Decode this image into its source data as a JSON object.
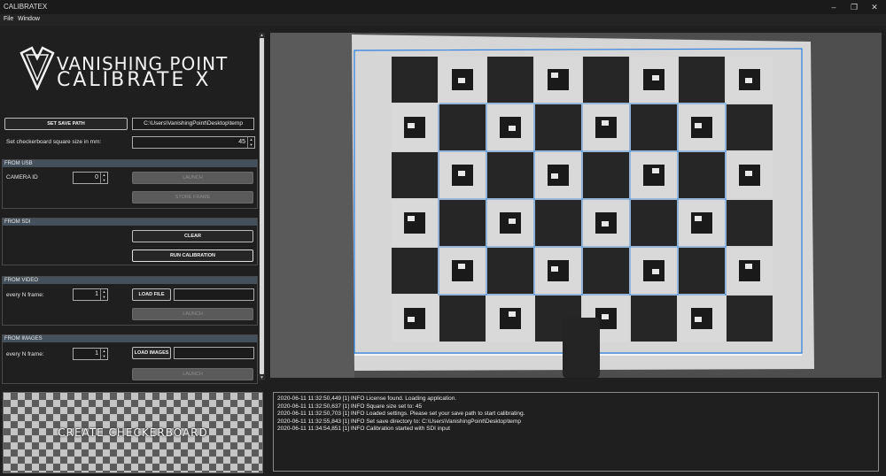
{
  "window": {
    "title": "CALIBRATEX"
  },
  "menu": [
    "File",
    "Window"
  ],
  "logo": {
    "line1": "VANISHING POINT",
    "line2": "CALIBRATE X"
  },
  "save": {
    "button_label": "SET SAVE PATH",
    "path": "C:\\Users\\VanishingPoint\\Desktop\\temp"
  },
  "square_size": {
    "label": "Set checkerboard square size in mm:",
    "value": "45"
  },
  "usb": {
    "header": "FROM USB",
    "camera_label": "CAMERA ID",
    "camera_value": "0",
    "launch_label": "LAUNCH",
    "store_label": "STORE FRAME"
  },
  "sdi": {
    "header": "FROM SDI",
    "clear_label": "CLEAR",
    "run_label": "RUN CALIBRATION"
  },
  "video": {
    "header": "FROM VIDEO",
    "every_label": "every N frame:",
    "every_value": "1",
    "load_label": "LOAD FILE",
    "launch_label": "LAUNCH"
  },
  "images": {
    "header": "FROM IMAGES",
    "every_label": "every N frame:",
    "every_value": "1",
    "load_label": "LOAD IMAGES",
    "launch_label": "LAUNCH"
  },
  "create_checkerboard": {
    "label": "CREATE CHECKERBOARD"
  },
  "log": [
    "2020-06-11 11:32:50,449 [1] INFO  License found. Loading application.",
    "2020-06-11 11:32:50,637 [1] INFO  Square size set to: 45",
    "2020-06-11 11:32:50,703 [1] INFO  Loaded settings. Please set your save path to start calibrating.",
    "2020-06-11 11:32:55,843 [1] INFO  Set save directory to: C:\\Users\\VanishingPoint\\Desktop\\temp",
    "2020-06-11 11:34:54,851 [1] INFO  Calibration started with SDI input"
  ],
  "colors": {
    "group_header": "#44505c",
    "detection_line": "#2a7fe0",
    "background": "#1f1f1f"
  }
}
